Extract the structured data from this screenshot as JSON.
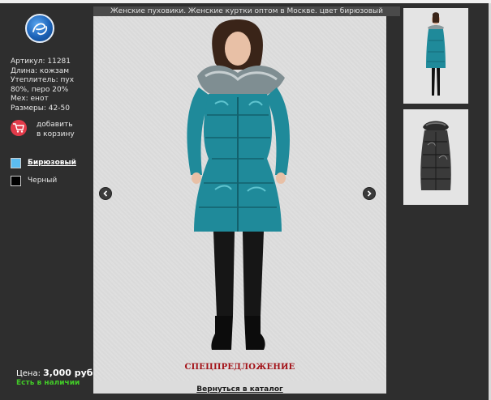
{
  "header": {
    "caption": "Женские пуховики. Женские куртки оптом в Москве. цвет бирюзовый"
  },
  "product": {
    "details": [
      "Артикул: 11281",
      "Длина: кожзам",
      "Утеплитель: пух 80%, перо 20%",
      "Мех: енот",
      "Размеры: 42-50"
    ],
    "add_to_cart": "добавить в корзину",
    "price_label": "Цена:",
    "price_value": "3,000 руб.",
    "stock": "Есть в наличии"
  },
  "colors": [
    {
      "label": "Бирюзовый",
      "hex": "#5cbcf0",
      "selected": true
    },
    {
      "label": "Черный",
      "hex": "#000000",
      "selected": false
    }
  ],
  "main": {
    "special": "СПЕЦПРЕДЛОЖЕНИЕ",
    "back_link": "Вернуться в каталог"
  },
  "theme": {
    "jacket_teal": "#1f8a9a",
    "cart_red": "#e23b4a",
    "stock_green": "#42c928",
    "special_red": "#a31218"
  },
  "icons": [
    "logo-icon",
    "cart-icon",
    "arrow-left-icon",
    "arrow-right-icon"
  ]
}
